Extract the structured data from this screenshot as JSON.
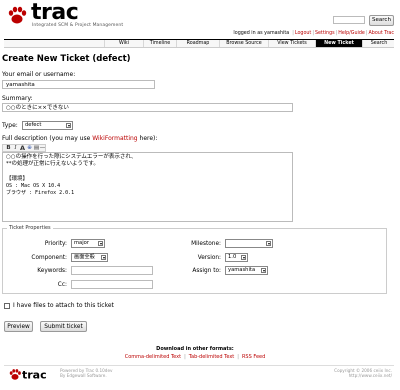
{
  "header": {
    "logo_text": "trac",
    "logo_tagline": "Integrated SCM & Project Management"
  },
  "search": {
    "button_label": "Search"
  },
  "metanav": {
    "logged_in": "logged in as yamashita",
    "items": [
      "Logout",
      "Settings",
      "Help/Guide",
      "About Trac"
    ]
  },
  "mainnav": {
    "tabs": [
      "Wiki",
      "Timeline",
      "Roadmap",
      "Browse Source",
      "View Tickets",
      "New Ticket",
      "Search"
    ],
    "active": "New Ticket"
  },
  "page": {
    "title": "Create New Ticket (defect)"
  },
  "form": {
    "reporter_label": "Your email or username:",
    "reporter_value": "yamashita",
    "summary_label": "Summary:",
    "summary_value": "○○のときに××できない",
    "type_label": "Type:",
    "type_value": "defect",
    "description_label_pre": "Full description (you may use ",
    "description_label_link": "WikiFormatting",
    "description_label_post": " here):",
    "toolbar": [
      "B",
      "I",
      "A",
      "⊕",
      "▤",
      "—"
    ],
    "description_lines": [
      "○○の操作を行った際にシステムエラーが表示され、",
      "**の処理が正常に行えないようです。",
      "",
      "【環境】",
      "OS : Mac OS X 10.4",
      "ブラウザ : Firefox 2.0.1"
    ]
  },
  "properties": {
    "legend": "Ticket Properties",
    "priority_label": "Priority:",
    "priority_value": "major",
    "component_label": "Component:",
    "component_value": "画面全般",
    "keywords_label": "Keywords:",
    "cc_label": "Cc:",
    "milestone_label": "Milestone:",
    "milestone_value": "",
    "version_label": "Version:",
    "version_value": "1.0",
    "assign_label": "Assign to:",
    "assign_value": "yamashita"
  },
  "attach": {
    "label": "I have files to attach to this ticket"
  },
  "buttons": {
    "preview": "Preview",
    "submit": "Submit ticket"
  },
  "altlinks": {
    "title": "Download in other formats:",
    "links": [
      "Comma-delimited Text",
      "Tab-delimited Text",
      "RSS Feed"
    ]
  },
  "footer": {
    "logo_text": "trac",
    "powered_by": "Powered by Trac 0.10dev",
    "by_line": "By Edgewall Software.",
    "copyright": "Copyright © 2006 ceiix Inc.",
    "url": "http://www.ceiix.net/"
  },
  "colors": {
    "accent": "#bb0000",
    "nav_active_bg": "#000000",
    "border": "#bbbbbb"
  }
}
